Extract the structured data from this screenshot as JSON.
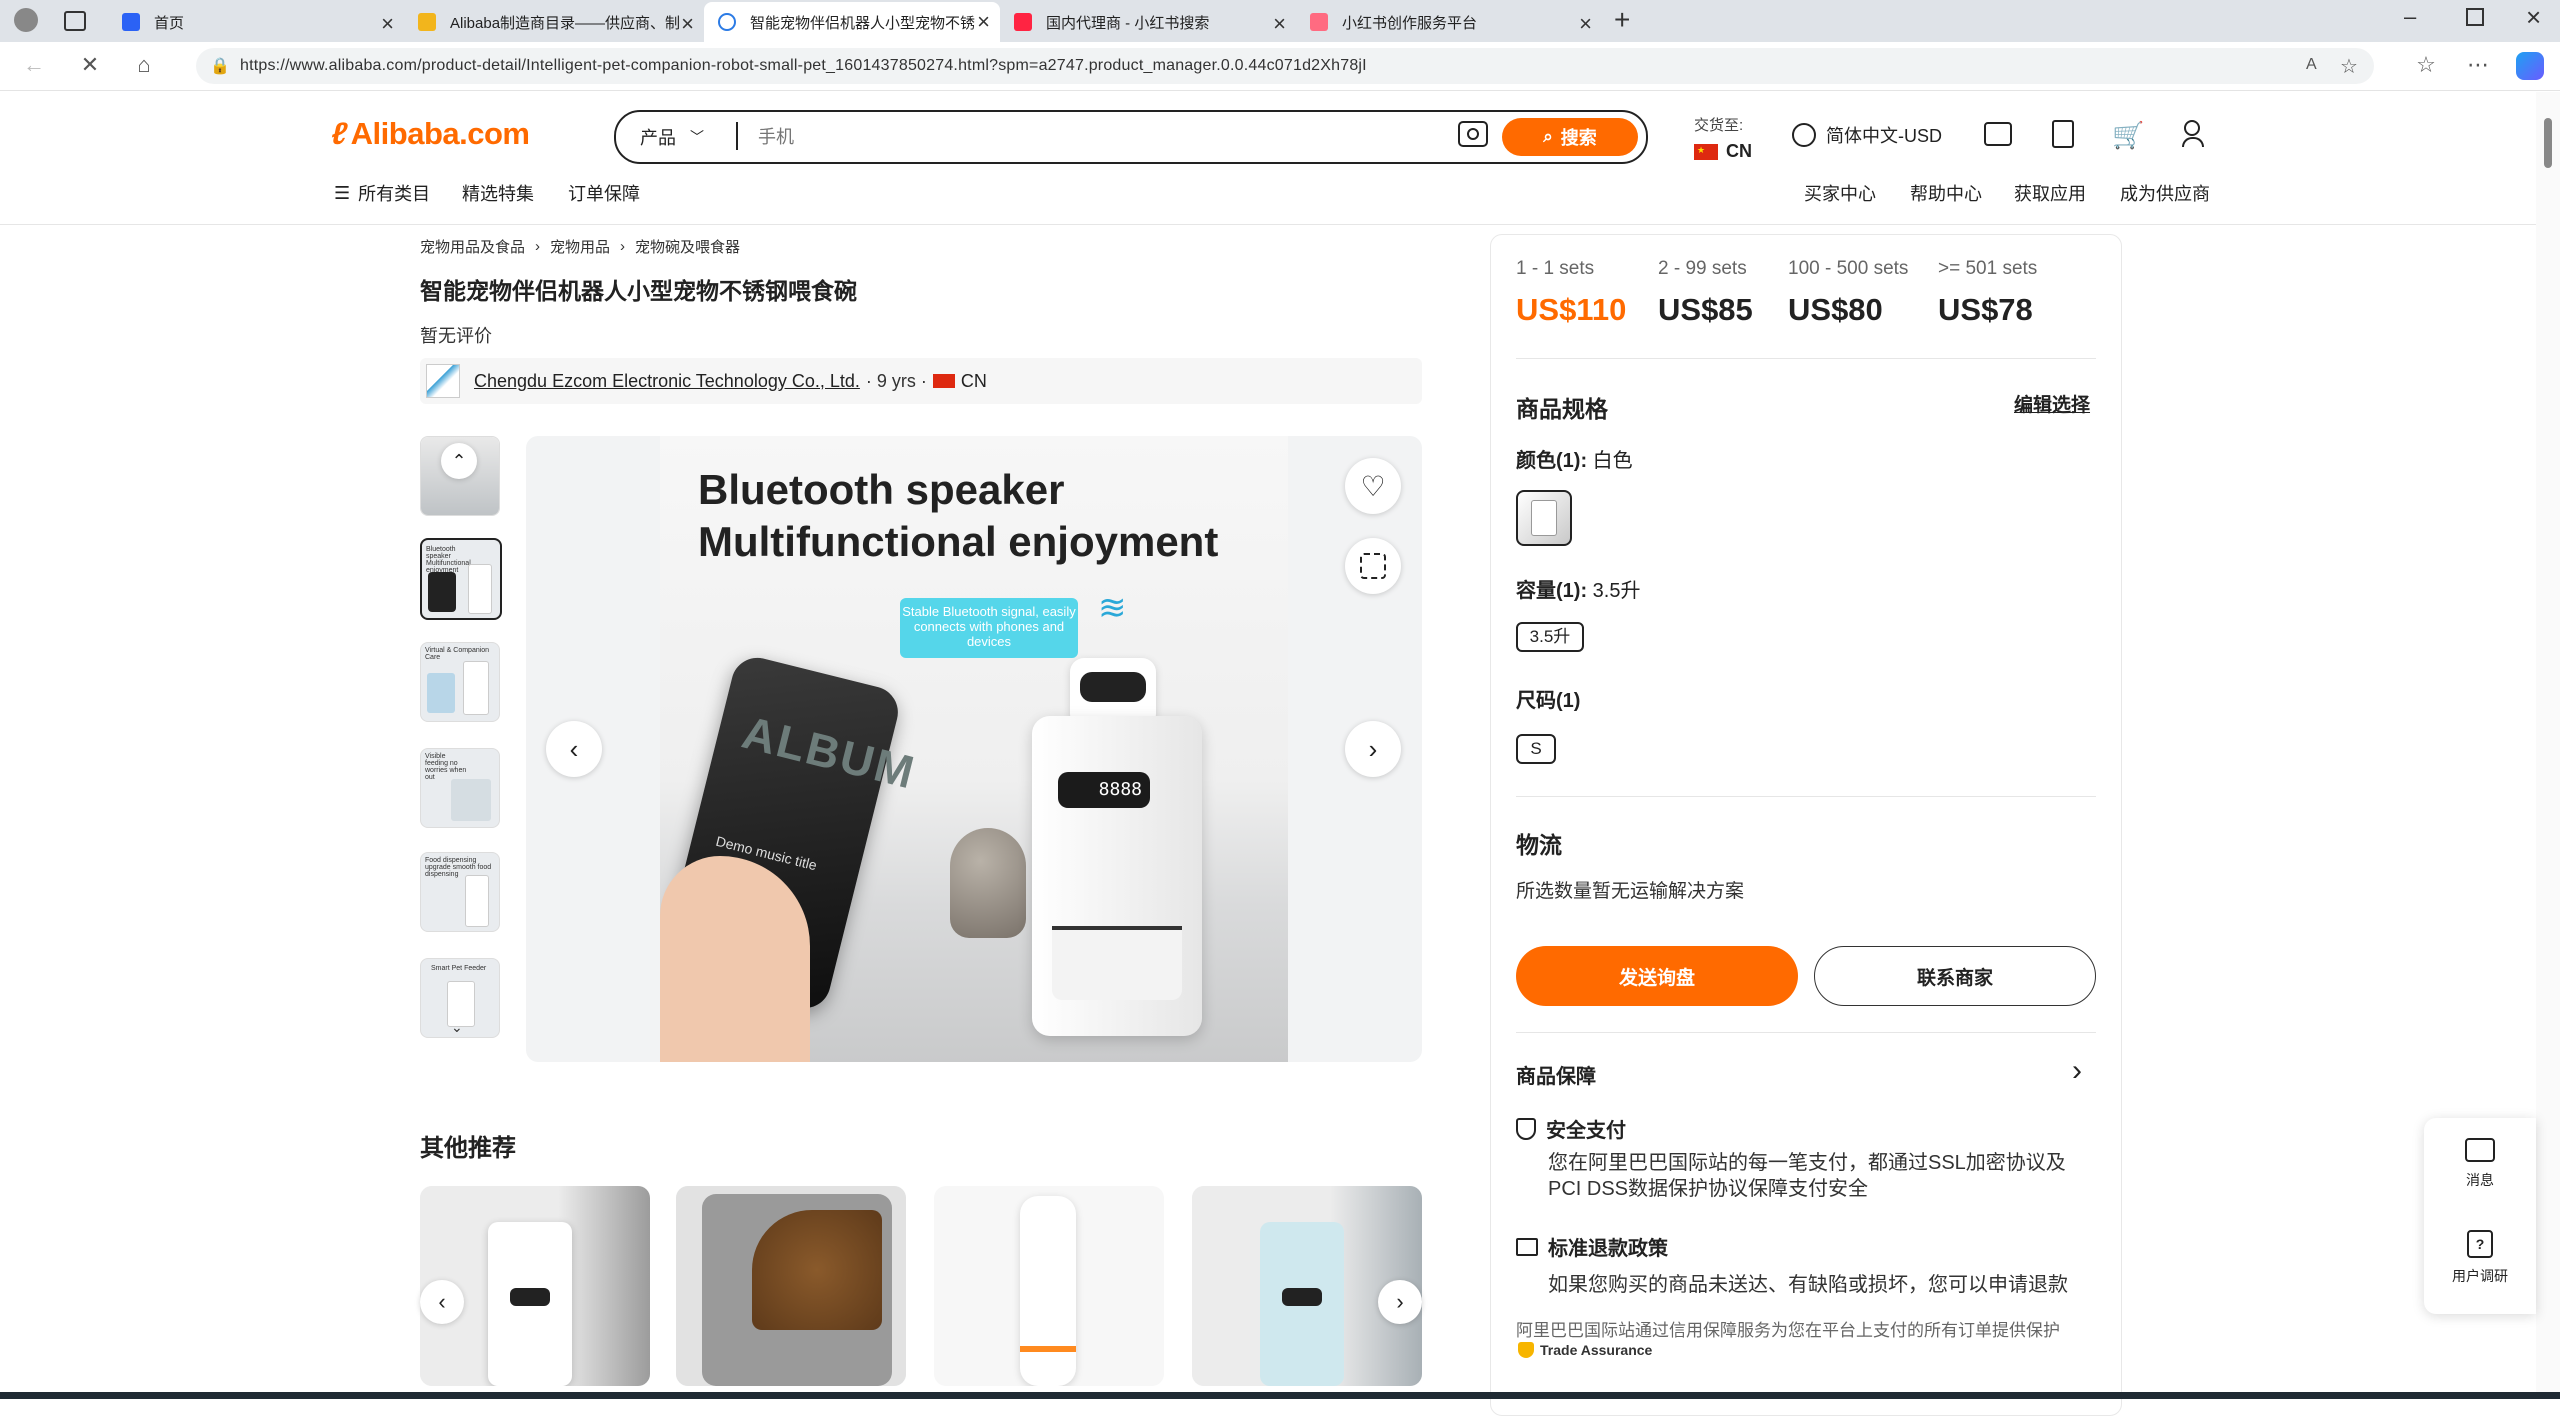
{
  "browser": {
    "tabs": [
      {
        "title": "首页",
        "color": "#2b62f5"
      },
      {
        "title": "Alibaba制造商目录——供应商、制",
        "color": "#f2b51c"
      },
      {
        "title": "智能宠物伴侣机器人小型宠物不锈",
        "color": "#2c7be5"
      },
      {
        "title": "国内代理商 - 小红书搜索",
        "color": "#ff2442"
      },
      {
        "title": "小红书创作服务平台",
        "color": "#ff6b81"
      }
    ],
    "url": "https://www.alibaba.com/product-detail/Intelligent-pet-companion-robot-small-pet_1601437850274.html?spm=a2747.product_manager.0.0.44c071d2Xh78jI"
  },
  "header": {
    "logo": "Alibaba.com",
    "search_category": "产品",
    "search_placeholder": "手机",
    "search_button": "搜索",
    "ship_to_label": "交货至:",
    "ship_to_country": "CN",
    "language": "简体中文-USD",
    "nav": [
      "所有类目",
      "精选特集",
      "订单保障"
    ],
    "nav_right": [
      "买家中心",
      "帮助中心",
      "获取应用",
      "成为供应商"
    ]
  },
  "breadcrumb": [
    "宠物用品及食品",
    "宠物用品",
    "宠物碗及喂食器"
  ],
  "product": {
    "title": "智能宠物伴侣机器人小型宠物不锈钢喂食碗",
    "rating": "暂无评价",
    "supplier": "Chengdu Ezcom Electronic Technology Co., Ltd.",
    "supplier_meta": "· 9 yrs ·",
    "supplier_country": "CN",
    "main_image": {
      "headline1": "Bluetooth speaker",
      "headline2": "Multifunctional enjoyment",
      "bubble": "Stable Bluetooth signal, easily connects with phones and devices",
      "phone_text": "ALBUM",
      "phone_song": "Demo music title",
      "display": "8888"
    },
    "thumbnails": [
      {
        "label": ""
      },
      {
        "label": "Bluetooth speaker Multifunctional enjoyment"
      },
      {
        "label": "Virtual & Companion Care"
      },
      {
        "label": "Visible feeding no worries when out"
      },
      {
        "label": "Food dispensing upgrade smooth food dispensing"
      },
      {
        "label": "Smart Pet Feeder"
      }
    ]
  },
  "pricing": {
    "tiers": [
      {
        "qty": "1 - 1 sets",
        "price": "US$110"
      },
      {
        "qty": "2 - 99 sets",
        "price": "US$85"
      },
      {
        "qty": "100 - 500 sets",
        "price": "US$80"
      },
      {
        "qty": ">= 501 sets",
        "price": "US$78"
      }
    ]
  },
  "specs": {
    "title": "商品规格",
    "edit": "编辑选择",
    "color_label": "颜色(1):",
    "color_value": "白色",
    "capacity_label": "容量(1):",
    "capacity_value": "3.5升",
    "capacity_option": "3.5升",
    "size_label": "尺码(1)",
    "size_option": "S"
  },
  "logistics": {
    "title": "物流",
    "text": "所选数量暂无运输解决方案"
  },
  "actions": {
    "inquiry": "发送询盘",
    "contact": "联系商家"
  },
  "protection": {
    "title": "商品保障",
    "secure_title": "安全支付",
    "secure_text_1": "您在阿里巴巴国际站的每一笔支付，都通过SSL加密协议及",
    "secure_text_2": "PCI DSS数据保护协议保障支付安全",
    "refund_title": "标准退款政策",
    "refund_text": "如果您购买的商品未送达、有缺陷或损坏，您可以申请退款",
    "footer": "阿里巴巴国际站通过信用保障服务为您在平台上支付的所有订单提供保护",
    "trade_assurance": "Trade Assurance"
  },
  "recommend": {
    "title": "其他推荐"
  },
  "float": {
    "message": "消息",
    "survey": "用户调研"
  }
}
